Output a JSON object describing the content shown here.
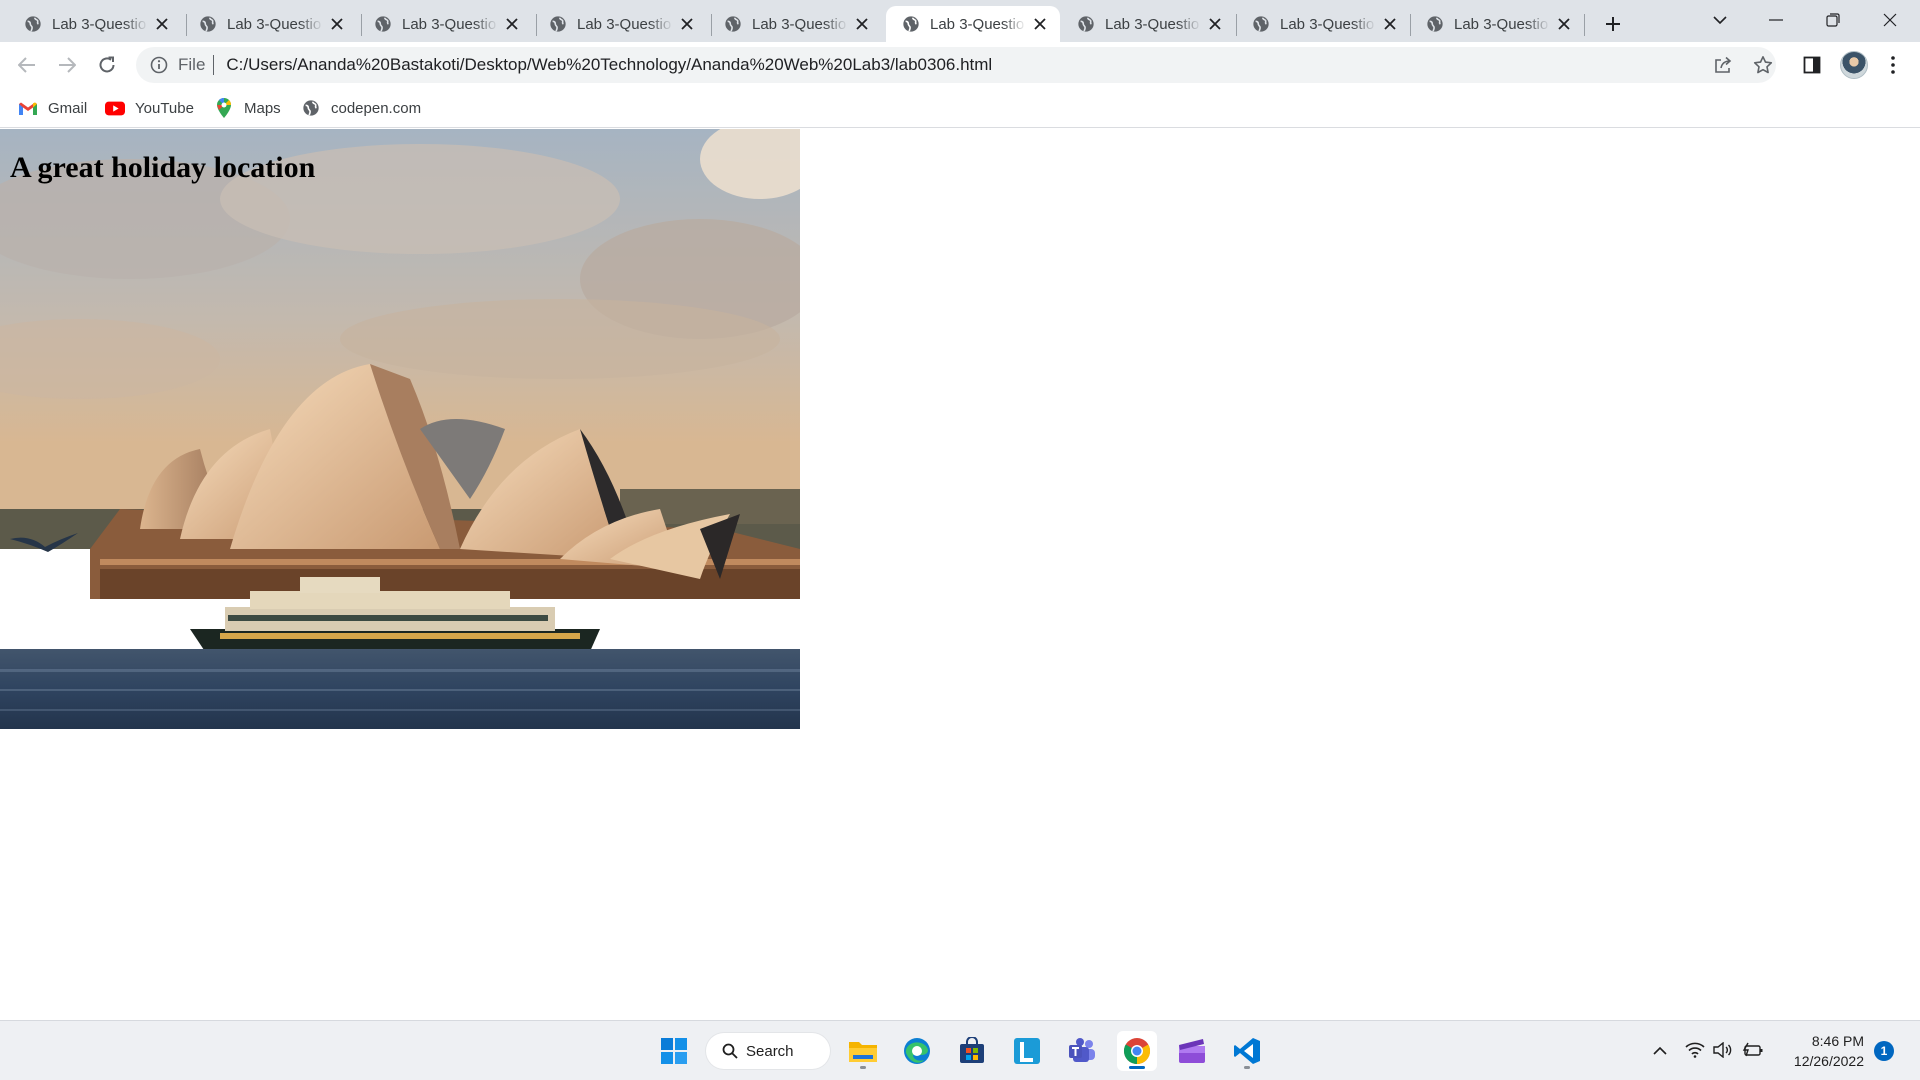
{
  "browser": {
    "tabs": [
      {
        "title": "Lab 3-Questio",
        "active": false
      },
      {
        "title": "Lab 3-Questio",
        "active": false
      },
      {
        "title": "Lab 3-Questio",
        "active": false
      },
      {
        "title": "Lab 3-Questio",
        "active": false
      },
      {
        "title": "Lab 3-Questio",
        "active": false
      },
      {
        "title": "Lab 3-Questio",
        "active": true
      },
      {
        "title": "Lab 3-Questio",
        "active": false
      },
      {
        "title": "Lab 3-Questio",
        "active": false
      },
      {
        "title": "Lab 3-Questio",
        "active": false
      }
    ],
    "address": {
      "scheme_label": "File",
      "url": "C:/Users/Ananda%20Bastakoti/Desktop/Web%20Technology/Ananda%20Web%20Lab3/lab0306.html"
    },
    "bookmarks": [
      {
        "label": "Gmail",
        "icon": "gmail-icon"
      },
      {
        "label": "YouTube",
        "icon": "youtube-icon"
      },
      {
        "label": "Maps",
        "icon": "maps-icon"
      },
      {
        "label": "codepen.com",
        "icon": "globe-icon"
      }
    ]
  },
  "page": {
    "heading": "A great holiday location",
    "image_subject": "sydney-opera-house-photo"
  },
  "taskbar": {
    "search_label": "Search",
    "time": "8:46 PM",
    "date": "12/26/2022",
    "notification_count": "1"
  },
  "colors": {
    "tabstrip_bg": "#dfe3e8",
    "omnibox_bg": "#f1f3f4",
    "taskbar_bg": "#eef0f3",
    "accent": "#0067c0"
  }
}
